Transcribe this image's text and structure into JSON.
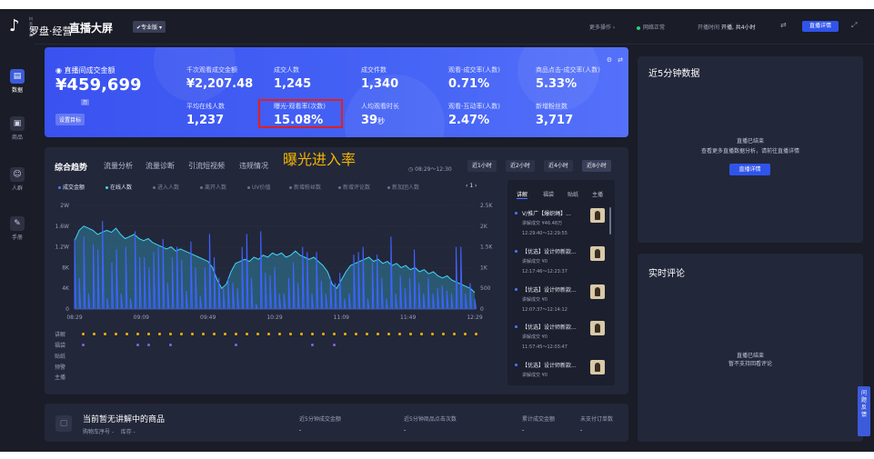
{
  "header": {
    "logo_small": "抖音电商",
    "logo_name": "罗盘·经营",
    "title": "直播大屏",
    "edition": "专业版",
    "more_actions": "更多操作",
    "network": "网络正常",
    "start_time_label": "开播时间",
    "start_time_value": "开播, 共4小时",
    "detail_button": "直播详情",
    "swap_icon": "swap-icon",
    "fullscreen_icon": "expand-icon"
  },
  "sidebar": {
    "items": [
      {
        "label": "数据",
        "icon": "data-icon",
        "active": true
      },
      {
        "label": "商品",
        "icon": "goods-icon",
        "active": false
      },
      {
        "label": "人群",
        "icon": "people-icon",
        "active": false
      },
      {
        "label": "手册",
        "icon": "manual-icon",
        "active": false
      }
    ]
  },
  "kpi": {
    "main_title": "直播间成交金额",
    "main_value": "¥459,699",
    "unit": "万",
    "goal_button": "设置目标",
    "row1": [
      {
        "label": "千次观看成交金额",
        "value": "¥2,207.48"
      },
      {
        "label": "成交人数",
        "value": "1,245"
      },
      {
        "label": "成交件数",
        "value": "1,340"
      },
      {
        "label": "观看-成交率(人数)",
        "value": "0.71%"
      },
      {
        "label": "商品点击-成交率(人数)",
        "value": "5.33%"
      }
    ],
    "row2": [
      {
        "label": "平均在线人数",
        "value": "1,237"
      },
      {
        "label": "曝光-观看率(次数)",
        "value": "15.08%"
      },
      {
        "label": "人均观看时长",
        "value": "39",
        "suffix": "秒"
      },
      {
        "label": "观看-互动率(人数)",
        "value": "2.47%"
      },
      {
        "label": "新增粉丝数",
        "value": "3,717"
      }
    ],
    "annotation": "曝光进入率"
  },
  "trend": {
    "tabs": [
      "综合趋势",
      "流量分析",
      "流量诊断",
      "引流短视频",
      "违规情况"
    ],
    "time_range_text": "08:29～12:30",
    "ranges": [
      "近1小时",
      "近2小时",
      "近4小时",
      "近8小时"
    ],
    "active_range": 3,
    "metrics": [
      {
        "label": "成交金额",
        "on": true
      },
      {
        "label": "在线人数",
        "on": true
      },
      {
        "label": "进入人数",
        "on": false
      },
      {
        "label": "离开人数",
        "on": false
      },
      {
        "label": "UV价值",
        "on": false
      },
      {
        "label": "新增粉丝数",
        "on": false
      },
      {
        "label": "新增评论数",
        "on": false
      },
      {
        "label": "新加团人数",
        "on": false
      }
    ],
    "pager": "1",
    "event_rows": [
      "讲解",
      "福袋",
      "贴纸",
      "预警",
      "主播"
    ]
  },
  "chart_data": {
    "type": "area",
    "title": "",
    "x_ticks": [
      "08:29",
      "09:09",
      "09:49",
      "10:29",
      "11:09",
      "11:49",
      "12:29"
    ],
    "y_left_ticks": [
      "0",
      "4K",
      "8K",
      "1.2W",
      "1.6W",
      "2W"
    ],
    "y_right_ticks": [
      "0",
      "500",
      "1K",
      "1.5K",
      "2K",
      "2.5K"
    ],
    "ylim_left": [
      0,
      20000
    ],
    "ylim_right": [
      0,
      2500
    ],
    "series": [
      {
        "name": "在线人数",
        "axis": "right",
        "color": "#3ed6ff",
        "values": [
          1650,
          1900,
          2000,
          1950,
          1900,
          1800,
          1850,
          1900,
          1850,
          1950,
          1800,
          1700,
          1750,
          1800,
          1700,
          1650,
          1700,
          1600,
          1550,
          1500,
          1450,
          1500,
          1400,
          1450,
          1400,
          1350,
          1300,
          1250,
          1200,
          1150,
          1000,
          700,
          500,
          600,
          900,
          1100,
          1150,
          1200,
          1150,
          1250,
          1200,
          1300,
          1250,
          1350,
          1300,
          1350,
          1250,
          1300,
          1400,
          1300,
          1250,
          1200,
          1250,
          1150,
          1050,
          900,
          600,
          500,
          700,
          900,
          1050,
          1100,
          1150,
          1200,
          1250,
          1150,
          1200,
          1100,
          1150,
          1050,
          1100,
          1000,
          1050,
          950,
          1000,
          900,
          950,
          850,
          900,
          800,
          750,
          800,
          700,
          650,
          600,
          550,
          500,
          400
        ]
      },
      {
        "name": "成交金额",
        "axis": "left",
        "color": "#3d63ff",
        "values": [
          13500,
          6000,
          14000,
          3000,
          12500,
          11500,
          17000,
          2000,
          9000,
          11500,
          3000,
          12000,
          2000,
          15000,
          10000,
          10000,
          8000,
          11000,
          12000,
          13500,
          5000,
          10000,
          12000,
          9500,
          3500,
          13000,
          8000,
          2500,
          8000,
          14500,
          10000,
          6000,
          4000,
          6000,
          5000,
          4000,
          12000,
          14500,
          6000,
          1000,
          15000,
          7000,
          6500,
          8000,
          3000,
          3000,
          6000,
          9000,
          5000,
          12000,
          11000,
          3000,
          11000,
          5500,
          3000,
          6000,
          5000,
          7000,
          2000,
          3000,
          10500,
          11000,
          12000,
          2000,
          9000,
          10500,
          6000,
          2000,
          14000,
          3000,
          6500,
          4000,
          6000,
          11500,
          5000,
          3000,
          6000,
          3000,
          4000,
          4500,
          3500,
          3000,
          12000,
          12000,
          3000,
          5000,
          2000
        ]
      }
    ]
  },
  "live_list": {
    "tabs": [
      "讲解",
      "福袋",
      "贴纸",
      "主播"
    ],
    "active_tab": 0,
    "items": [
      {
        "title": "V/推广【爆织绳】...",
        "sub": "讲解成交 ¥46.48万",
        "time": "12:29:40～12:29:55"
      },
      {
        "title": "【优选】设计师新款...",
        "sub": "讲解成交 ¥0",
        "time": "12:17:46～12:23:37"
      },
      {
        "title": "【优选】设计师新款...",
        "sub": "讲解成交 ¥0",
        "time": "12:07:37～12:14:12"
      },
      {
        "title": "【优选】设计师新款...",
        "sub": "讲解成交 ¥0",
        "time": "11:57:45～12:03:47"
      },
      {
        "title": "【优选】设计师新款...",
        "sub": "讲解成交 ¥0",
        "time": ""
      }
    ]
  },
  "bottom": {
    "title": "当前暂无讲解中的商品",
    "sub": "购物车序号 -    库存 -",
    "columns": [
      {
        "label": "近5分钟成交金额",
        "value": "-"
      },
      {
        "label": "近5分钟商品点击次数",
        "value": "-"
      },
      {
        "label": "累计成交金额",
        "value": "-"
      },
      {
        "label": "未支付订单数",
        "value": "-"
      }
    ]
  },
  "right_panels": {
    "recent5": {
      "title": "近5分钟数据",
      "msg1": "直播已结束",
      "msg2": "查看更多直播数据分析，请前往直播详情",
      "button": "直播详情"
    },
    "comments": {
      "title": "实时评论",
      "msg1": "直播已结束",
      "msg2": "暂不支持回看评论"
    }
  },
  "feedback": "问题反馈"
}
